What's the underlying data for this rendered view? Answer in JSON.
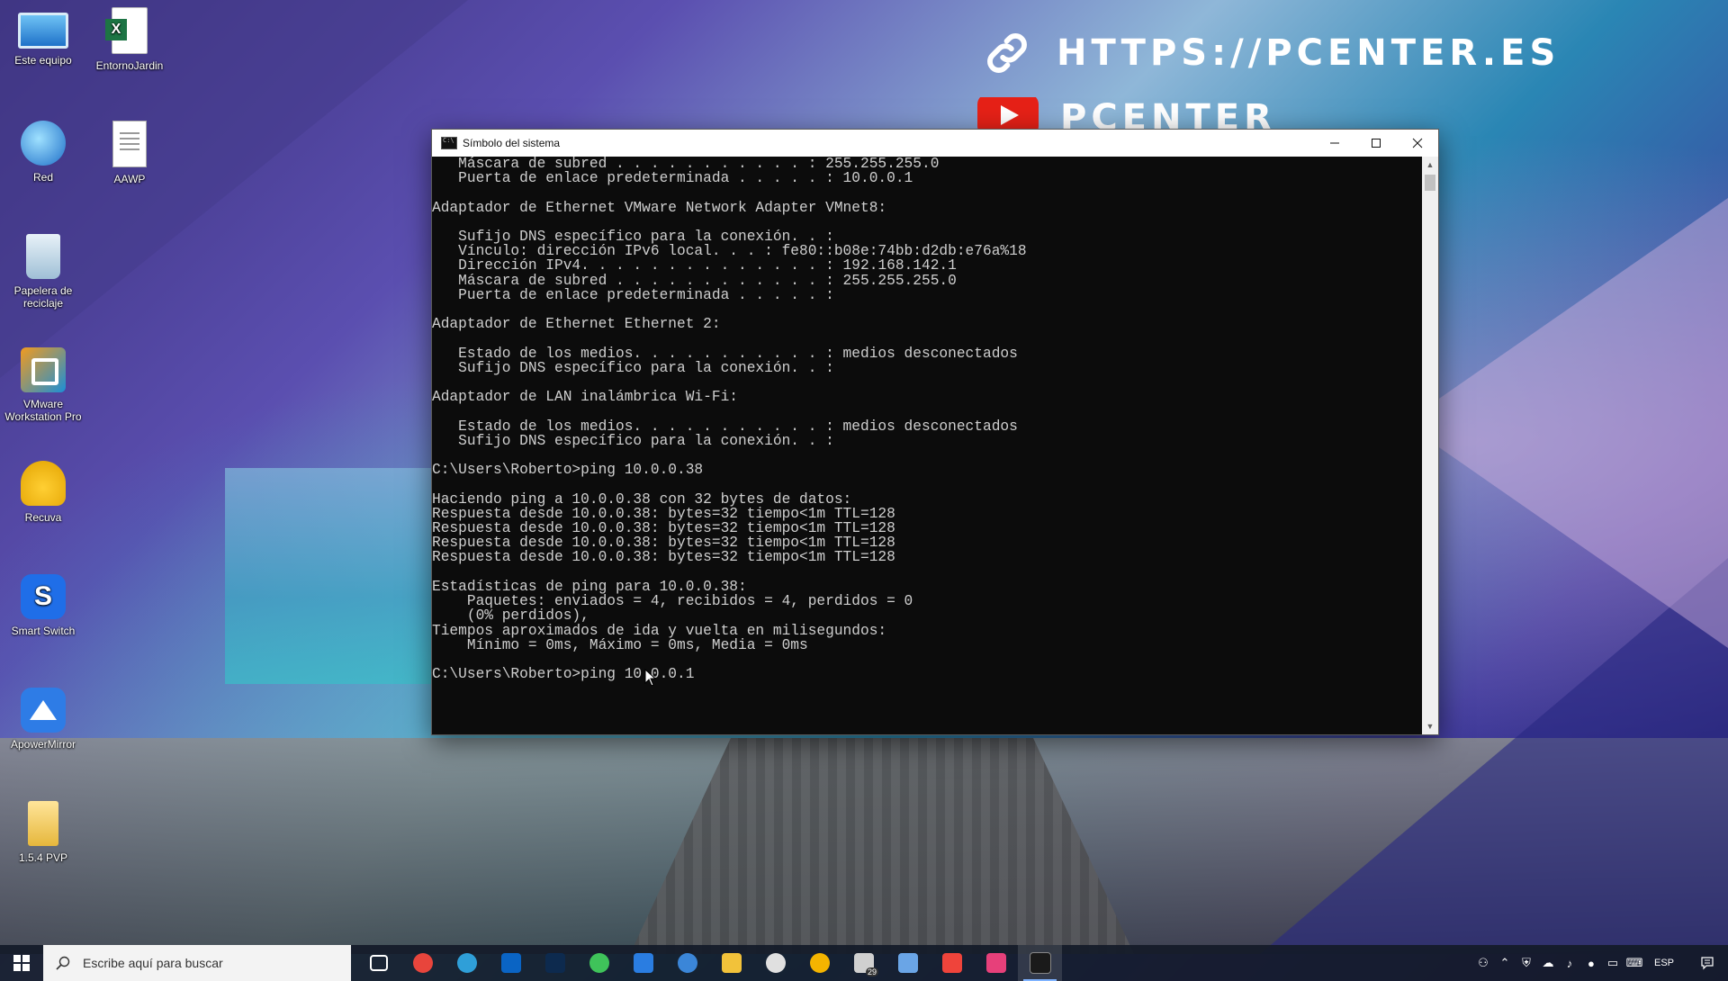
{
  "banner": {
    "link_text": "HTTPS://PCENTER.ES",
    "channel_text": "PCENTER"
  },
  "desktop_icons": [
    {
      "label": "Este equipo",
      "icon": "computer-icon"
    },
    {
      "label": "EntornoJardin",
      "icon": "excel-file-icon"
    },
    {
      "label": "Red",
      "icon": "network-icon"
    },
    {
      "label": "AAWP",
      "icon": "text-file-icon"
    },
    {
      "label": "Papelera de reciclaje",
      "icon": "recycle-bin-icon"
    },
    {
      "label": "VMware Workstation Pro",
      "icon": "vmware-icon"
    },
    {
      "label": "Recuva",
      "icon": "recuva-icon"
    },
    {
      "label": "Smart Switch",
      "icon": "smart-switch-icon"
    },
    {
      "label": "ApowerMirror",
      "icon": "apowermirror-icon"
    },
    {
      "label": "1.5.4 PVP",
      "icon": "folder-icon"
    }
  ],
  "window": {
    "title": "Símbolo del sistema",
    "console_lines": [
      "   Máscara de subred . . . . . . . . . . . : 255.255.255.0",
      "   Puerta de enlace predeterminada . . . . . : 10.0.0.1",
      "",
      "Adaptador de Ethernet VMware Network Adapter VMnet8:",
      "",
      "   Sufijo DNS específico para la conexión. . :",
      "   Vínculo: dirección IPv6 local. . . : fe80::b08e:74bb:d2db:e76a%18",
      "   Dirección IPv4. . . . . . . . . . . . . . : 192.168.142.1",
      "   Máscara de subred . . . . . . . . . . . . : 255.255.255.0",
      "   Puerta de enlace predeterminada . . . . . :",
      "",
      "Adaptador de Ethernet Ethernet 2:",
      "",
      "   Estado de los medios. . . . . . . . . . . : medios desconectados",
      "   Sufijo DNS específico para la conexión. . :",
      "",
      "Adaptador de LAN inalámbrica Wi-Fi:",
      "",
      "   Estado de los medios. . . . . . . . . . . : medios desconectados",
      "   Sufijo DNS específico para la conexión. . :",
      "",
      "C:\\Users\\Roberto>ping 10.0.0.38",
      "",
      "Haciendo ping a 10.0.0.38 con 32 bytes de datos:",
      "Respuesta desde 10.0.0.38: bytes=32 tiempo<1m TTL=128",
      "Respuesta desde 10.0.0.38: bytes=32 tiempo<1m TTL=128",
      "Respuesta desde 10.0.0.38: bytes=32 tiempo<1m TTL=128",
      "Respuesta desde 10.0.0.38: bytes=32 tiempo<1m TTL=128",
      "",
      "Estadísticas de ping para 10.0.0.38:",
      "    Paquetes: enviados = 4, recibidos = 4, perdidos = 0",
      "    (0% perdidos),",
      "Tiempos aproximados de ida y vuelta en milisegundos:",
      "    Mínimo = 0ms, Máximo = 0ms, Media = 0ms",
      "",
      "C:\\Users\\Roberto>ping 10.0.0.1"
    ]
  },
  "taskbar": {
    "search_placeholder": "Escribe aquí para buscar",
    "apps": [
      {
        "name": "task-view-icon",
        "color": "#ffffff"
      },
      {
        "name": "chrome-icon",
        "color": "#e8453c"
      },
      {
        "name": "edge-icon",
        "color": "#2f9fd8"
      },
      {
        "name": "outlook-icon",
        "color": "#0a64c4"
      },
      {
        "name": "photoshop-icon",
        "color": "#0d2a4e"
      },
      {
        "name": "whatsapp-icon",
        "color": "#3fc35a"
      },
      {
        "name": "pen-app-icon",
        "color": "#2a7de1"
      },
      {
        "name": "edge-beta-icon",
        "color": "#3b86d8"
      },
      {
        "name": "file-explorer-icon",
        "color": "#f2c23a"
      },
      {
        "name": "aperture-app-icon",
        "color": "#e0e0e0"
      },
      {
        "name": "weather-icon",
        "color": "#f4b400"
      },
      {
        "name": "notes-app-icon",
        "color": "#d0d0d0"
      },
      {
        "name": "onedrive-sync-icon",
        "color": "#6aa5e6"
      },
      {
        "name": "anydesk-icon",
        "color": "#ef443b"
      },
      {
        "name": "screen-capture-icon",
        "color": "#e7407a"
      },
      {
        "name": "command-prompt-icon",
        "color": "#1a1a1a"
      }
    ],
    "notes_badge": "29",
    "language": "ESP"
  }
}
